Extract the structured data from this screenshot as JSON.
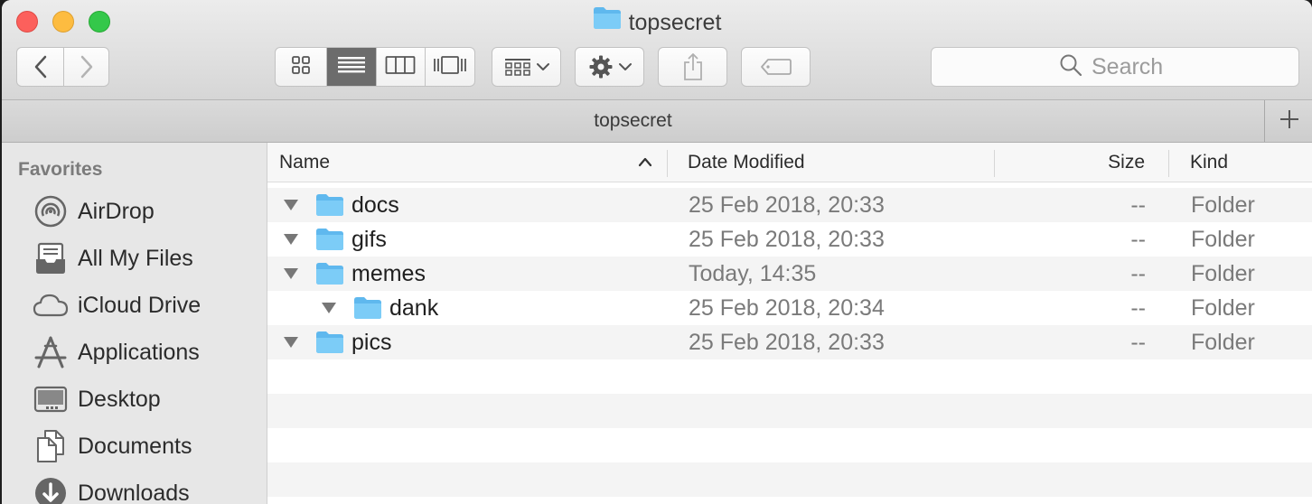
{
  "window": {
    "title": "topsecret"
  },
  "toolbar": {
    "back_icon": "chevron-left-icon",
    "forward_icon": "chevron-right-icon",
    "view_modes": [
      "icon-view-icon",
      "list-view-icon",
      "column-view-icon",
      "cover-flow-icon"
    ],
    "active_view": "list",
    "arrange_icon": "arrange-grid-icon",
    "action_icon": "gear-icon",
    "share_icon": "share-icon",
    "tag_icon": "tag-icon",
    "search": {
      "placeholder": "Search"
    }
  },
  "tabbar": {
    "tab_title": "topsecret",
    "add_icon": "plus-icon"
  },
  "sidebar": {
    "heading": "Favorites",
    "items": [
      {
        "label": "AirDrop",
        "icon": "airdrop-icon"
      },
      {
        "label": "All My Files",
        "icon": "all-files-icon"
      },
      {
        "label": "iCloud Drive",
        "icon": "cloud-icon"
      },
      {
        "label": "Applications",
        "icon": "applications-icon"
      },
      {
        "label": "Desktop",
        "icon": "desktop-icon"
      },
      {
        "label": "Documents",
        "icon": "documents-icon"
      },
      {
        "label": "Downloads",
        "icon": "downloads-icon"
      }
    ]
  },
  "columns": {
    "name": "Name",
    "date": "Date Modified",
    "size": "Size",
    "kind": "Kind",
    "sort_icon": "chevron-up-icon"
  },
  "files": [
    {
      "name": "docs",
      "date": "25 Feb 2018, 20:33",
      "size": "--",
      "kind": "Folder",
      "depth": 0
    },
    {
      "name": "gifs",
      "date": "25 Feb 2018, 20:33",
      "size": "--",
      "kind": "Folder",
      "depth": 0
    },
    {
      "name": "memes",
      "date": "Today, 14:35",
      "size": "--",
      "kind": "Folder",
      "depth": 0
    },
    {
      "name": "dank",
      "date": "25 Feb 2018, 20:34",
      "size": "--",
      "kind": "Folder",
      "depth": 1
    },
    {
      "name": "pics",
      "date": "25 Feb 2018, 20:33",
      "size": "--",
      "kind": "Folder",
      "depth": 0
    }
  ],
  "colors": {
    "folder_blue": "#6ec4f5",
    "close": "#fc605c",
    "minimize": "#fdbc40",
    "maximize": "#34c84a"
  }
}
